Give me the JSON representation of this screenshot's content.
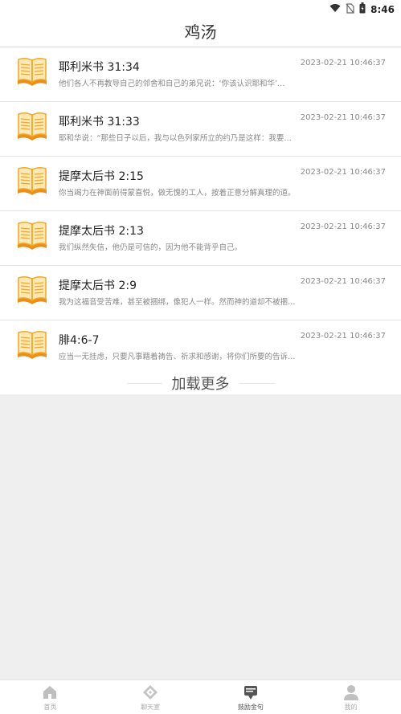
{
  "status_bar": {
    "time": "8:46"
  },
  "header": {
    "title": "鸡汤"
  },
  "items": [
    {
      "title": "耶利米书 31:34",
      "time": "2023-02-21 10:46:37",
      "excerpt": "他们各人不再教导自己的邻舍和自己的弟兄说：‘你该认识耶和华’…"
    },
    {
      "title": "耶利米书 31:33",
      "time": "2023-02-21 10:46:37",
      "excerpt": "耶和华说：“那些日子以后，我与以色列家所立的约乃是这样：我要…"
    },
    {
      "title": "提摩太后书 2:15",
      "time": "2023-02-21 10:46:37",
      "excerpt": "你当竭力在神面前得蒙喜悦，做无愧的工人，按着正意分解真理的道。"
    },
    {
      "title": "提摩太后书 2:13",
      "time": "2023-02-21 10:46:37",
      "excerpt": "我们纵然失信，他仍是可信的，因为他不能背乎自己。"
    },
    {
      "title": "提摩太后书 2:9",
      "time": "2023-02-21 10:46:37",
      "excerpt": "我为这福音受苦难，甚至被捆绑，像犯人一样。然而神的道却不被捆…"
    },
    {
      "title": "腓4:6-7",
      "time": "2023-02-21 10:46:37",
      "excerpt": "应当一无挂虑，只要凡事藉着祷告、祈求和感谢，将你们所要的告诉…"
    }
  ],
  "load_more": "加载更多",
  "tabs": [
    {
      "label": "首页",
      "icon": "home-icon"
    },
    {
      "label": "聊天室",
      "icon": "diamond-icon"
    },
    {
      "label": "鼓励金句",
      "icon": "quote-card-icon"
    },
    {
      "label": "我的",
      "icon": "user-icon"
    }
  ],
  "colors": {
    "book_orange": "#F5A623",
    "book_cream": "#FCE9B6",
    "active_tab": "#555555"
  }
}
